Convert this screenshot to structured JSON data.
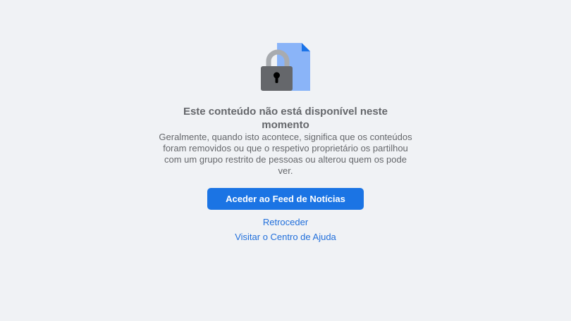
{
  "content_unavailable": {
    "illustration_icon": "locked-document-icon",
    "title": "Este conteúdo não está disponível neste momento",
    "description": "Geralmente, quando isto acontece, significa que os conteúdos foram removidos ou que o respetivo proprietário os partilhou com um grupo restrito de pessoas ou alterou quem os pode ver.",
    "primary_button_label": "Aceder ao Feed de Notícias",
    "back_link_label": "Retroceder",
    "help_link_label": "Visitar o Centro de Ajuda"
  },
  "colors": {
    "background": "#f0f2f5",
    "text_secondary": "#65676b",
    "primary_button": "#1b74e4",
    "link": "#216fdb",
    "document": "#8ab4f8",
    "document_fold": "#1a73e8",
    "lock_body": "#65676b",
    "lock_shackle": "#a8abaf"
  }
}
